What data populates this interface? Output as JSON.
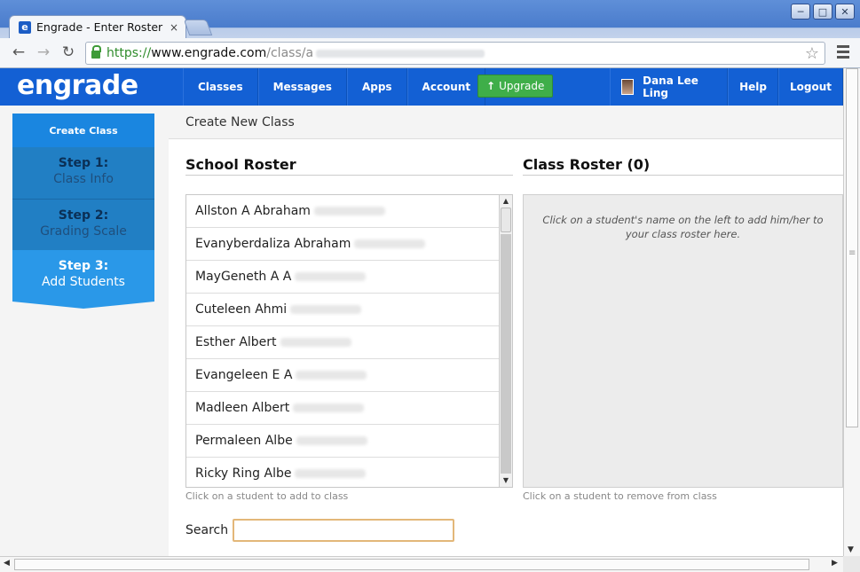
{
  "browser": {
    "tab_title": "Engrade - Enter Roster",
    "tab_close": "×",
    "url_scheme": "https://",
    "url_host": "www.engrade.com",
    "url_path": "/class/a",
    "win_minimize": "─",
    "win_maximize": "□",
    "win_close": "✕",
    "back": "←",
    "forward": "→",
    "reload": "↻",
    "star": "☆"
  },
  "header": {
    "logo": "engrade",
    "nav": [
      "Classes",
      "Messages",
      "Apps",
      "Account"
    ],
    "upgrade_label": "Upgrade",
    "user_name": "Dana Lee Ling",
    "help": "Help",
    "logout": "Logout"
  },
  "sidebar": {
    "create_class": "Create Class",
    "steps": [
      {
        "num": "Step 1:",
        "label": "Class Info"
      },
      {
        "num": "Step 2:",
        "label": "Grading Scale"
      },
      {
        "num": "Step 3:",
        "label": "Add Students"
      }
    ]
  },
  "page": {
    "title": "Create New Class",
    "school_roster_title": "School Roster",
    "class_roster_title": "Class Roster (0)",
    "class_roster_msg": "Click on a student's name on the left to add him/her to your class roster here.",
    "school_hint": "Click on a student to add to class",
    "class_hint": "Click on a student to remove from class",
    "search_label": "Search",
    "search_value": ""
  },
  "students": [
    "Allston A Abraham",
    "Evanyberdaliza Abraham",
    "MayGeneth A A",
    "Cuteleen Ahmi",
    "Esther Albert",
    "Evangeleen E A",
    "Madleen Albert",
    "Permaleen Albe",
    "Ricky Ring Albe"
  ]
}
